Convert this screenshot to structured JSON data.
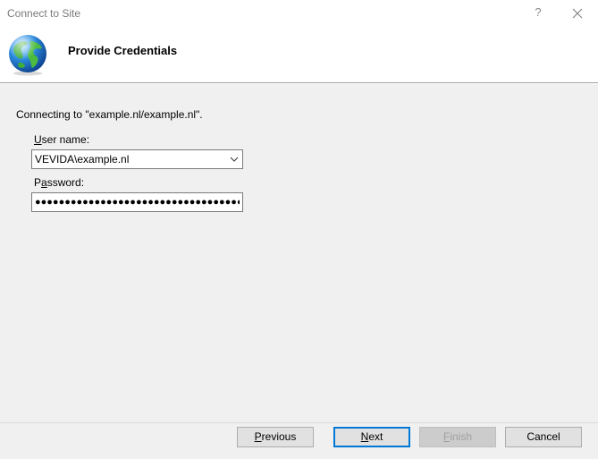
{
  "window": {
    "title": "Connect to Site",
    "help_glyph": "?"
  },
  "header": {
    "title": "Provide Credentials",
    "icon": "globe-icon"
  },
  "main": {
    "connecting_text": "Connecting to \"example.nl/example.nl\".",
    "username": {
      "label_accel": "U",
      "label_rest": "ser name:",
      "value": "VEVIDA\\example.nl"
    },
    "password": {
      "label_pre": "P",
      "label_accel": "a",
      "label_rest": "ssword:",
      "masked_value": "●●●●●●●●●●●●●●●●●●●●●●●●●●●●●●●●●●●●"
    }
  },
  "footer": {
    "previous": {
      "accel": "P",
      "rest": "revious"
    },
    "next": {
      "accel": "N",
      "rest": "ext"
    },
    "finish": {
      "accel": "F",
      "rest": "inish"
    },
    "cancel": "Cancel"
  },
  "colors": {
    "content_bg": "#f0f0f0",
    "accent": "#0078d7"
  }
}
